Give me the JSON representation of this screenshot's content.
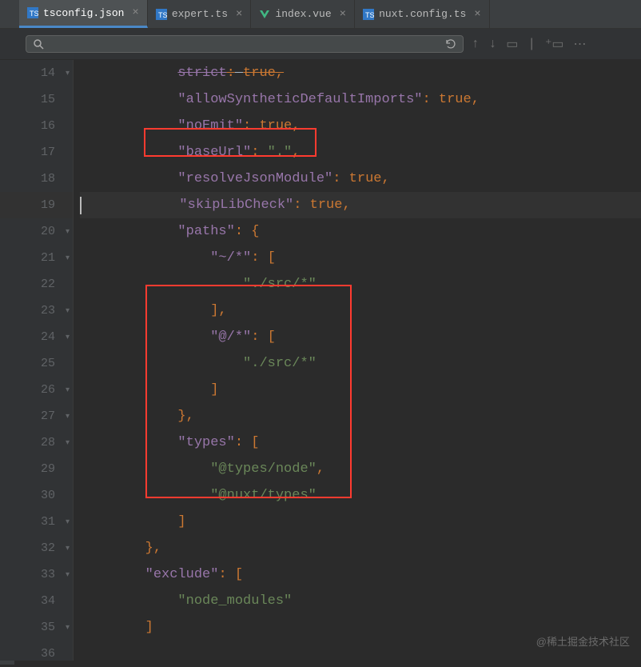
{
  "tabs": [
    {
      "name": "tsconfig.json",
      "icon": "ts-json"
    },
    {
      "name": "expert.ts",
      "icon": "ts"
    },
    {
      "name": "index.vue",
      "icon": "vue"
    },
    {
      "name": "nuxt.config.ts",
      "icon": "ts"
    }
  ],
  "code": {
    "lines": [
      {
        "n": 14,
        "ind": 8,
        "tokens": [
          [
            "k",
            "strict"
          ],
          [
            "p",
            ":"
          ],
          [
            "c",
            " "
          ],
          [
            "kw",
            "true"
          ],
          [
            "p",
            ","
          ]
        ],
        "strike": true
      },
      {
        "n": 15,
        "ind": 8,
        "tokens": [
          [
            "k",
            "\"allowSyntheticDefaultImports\""
          ],
          [
            "p",
            ": "
          ],
          [
            "kw",
            "true"
          ],
          [
            "p",
            ","
          ]
        ]
      },
      {
        "n": 16,
        "ind": 8,
        "tokens": [
          [
            "k",
            "\"noEmit\""
          ],
          [
            "p",
            ": "
          ],
          [
            "kw",
            "true"
          ],
          [
            "p",
            ","
          ]
        ]
      },
      {
        "n": 17,
        "ind": 8,
        "tokens": [
          [
            "k",
            "\"baseUrl\""
          ],
          [
            "p",
            ": "
          ],
          [
            "s",
            "\".\""
          ],
          [
            "p",
            ","
          ]
        ]
      },
      {
        "n": 18,
        "ind": 8,
        "tokens": [
          [
            "k",
            "\"resolveJsonModule\""
          ],
          [
            "p",
            ": "
          ],
          [
            "kw",
            "true"
          ],
          [
            "p",
            ","
          ]
        ]
      },
      {
        "n": 19,
        "ind": 8,
        "tokens": [
          [
            "k",
            "\"skipLibCheck\""
          ],
          [
            "p",
            ": "
          ],
          [
            "kw",
            "true"
          ],
          [
            "p",
            ","
          ]
        ],
        "current": true
      },
      {
        "n": 20,
        "ind": 8,
        "tokens": [
          [
            "k",
            "\"paths\""
          ],
          [
            "p",
            ": {"
          ]
        ]
      },
      {
        "n": 21,
        "ind": 12,
        "tokens": [
          [
            "k",
            "\"~/*\""
          ],
          [
            "p",
            ": ["
          ]
        ]
      },
      {
        "n": 22,
        "ind": 16,
        "tokens": [
          [
            "s",
            "\"./src/*\""
          ]
        ]
      },
      {
        "n": 23,
        "ind": 12,
        "tokens": [
          [
            "p",
            "],"
          ]
        ]
      },
      {
        "n": 24,
        "ind": 12,
        "tokens": [
          [
            "k",
            "\"@/*\""
          ],
          [
            "p",
            ": ["
          ]
        ]
      },
      {
        "n": 25,
        "ind": 16,
        "tokens": [
          [
            "s",
            "\"./src/*\""
          ]
        ]
      },
      {
        "n": 26,
        "ind": 12,
        "tokens": [
          [
            "p",
            "]"
          ]
        ]
      },
      {
        "n": 27,
        "ind": 8,
        "tokens": [
          [
            "p",
            "},"
          ]
        ]
      },
      {
        "n": 28,
        "ind": 8,
        "tokens": [
          [
            "k",
            "\"types\""
          ],
          [
            "p",
            ": ["
          ]
        ]
      },
      {
        "n": 29,
        "ind": 12,
        "tokens": [
          [
            "s",
            "\"@types/node\""
          ],
          [
            "p",
            ","
          ]
        ]
      },
      {
        "n": 30,
        "ind": 12,
        "tokens": [
          [
            "s",
            "\"@nuxt/types\""
          ]
        ]
      },
      {
        "n": 31,
        "ind": 8,
        "tokens": [
          [
            "p",
            "]"
          ]
        ]
      },
      {
        "n": 32,
        "ind": 4,
        "tokens": [
          [
            "p",
            "},"
          ]
        ]
      },
      {
        "n": 33,
        "ind": 4,
        "tokens": [
          [
            "k",
            "\"exclude\""
          ],
          [
            "p",
            ": ["
          ]
        ]
      },
      {
        "n": 34,
        "ind": 8,
        "tokens": [
          [
            "s",
            "\"node_modules\""
          ]
        ]
      },
      {
        "n": 35,
        "ind": 4,
        "tokens": [
          [
            "p",
            "]"
          ]
        ]
      },
      {
        "n": 36,
        "ind": 0,
        "tokens": []
      }
    ]
  },
  "watermark": "@稀土掘金技术社区",
  "search_placeholder": ""
}
